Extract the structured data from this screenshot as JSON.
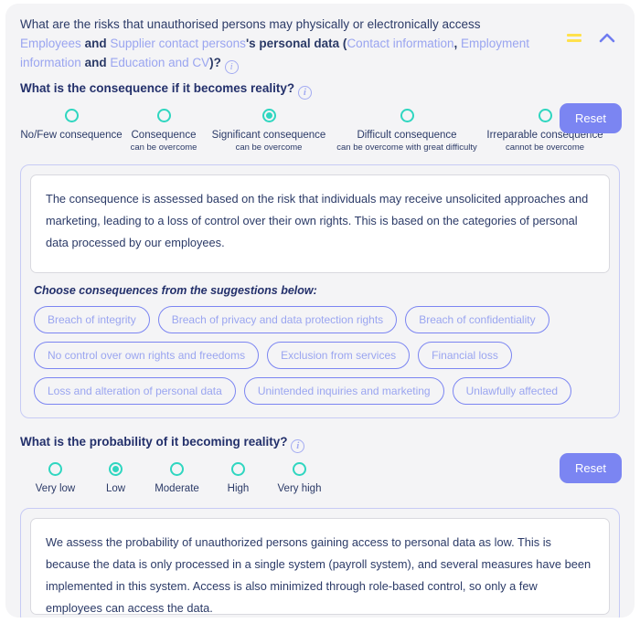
{
  "header": {
    "question_line1": "What are the risks that unauthorised persons may physically or electronically access",
    "link_employees": "Employees",
    "and_1": "and",
    "link_supplier": "Supplier contact persons",
    "mid_text": "'s personal data (",
    "link_contact_info": "Contact information",
    "comma": ", ",
    "link_employment_info": "Employment information",
    "and_2": "and",
    "link_education": "Education and CV",
    "tail_text": ")?",
    "info_icon": "info-icon",
    "bars_icon": "bars-icon",
    "chevron_icon": "chevron-up-icon"
  },
  "consequence": {
    "label": "What is the consequence if it becomes reality?",
    "reset_label": "Reset",
    "selected_index": 2,
    "options": [
      {
        "label": "No/Few consequence",
        "sub": ""
      },
      {
        "label": "Consequence",
        "sub": "can be overcome"
      },
      {
        "label": "Significant consequence",
        "sub": "can be overcome"
      },
      {
        "label": "Difficult consequence",
        "sub": "can be overcome with great difficulty"
      },
      {
        "label": "Irreparable consequence",
        "sub": "cannot be overcome"
      }
    ],
    "answer": "The consequence is assessed based on the risk that individuals may receive unsolicited approaches and marketing, leading to a loss of control over their own rights. This is based on the categories of personal data processed by our employees.",
    "suggestions_title": "Choose consequences from the suggestions below:",
    "suggestions": [
      "Breach of integrity",
      "Breach of privacy and data protection rights",
      "Breach of confidentiality",
      "No control over own rights and freedoms",
      "Exclusion from services",
      "Financial loss",
      "Loss and alteration of personal data",
      "Unintended inquiries and marketing",
      "Unlawfully affected"
    ]
  },
  "probability": {
    "label": "What is the probability of it becoming reality?",
    "reset_label": "Reset",
    "selected_index": 1,
    "options": [
      "Very low",
      "Low",
      "Moderate",
      "High",
      "Very high"
    ],
    "answer": "We assess the probability of unauthorized persons gaining access to personal data as low. This is because the data is only processed in a single system (payroll system), and several measures have been implemented in this system. Access is also minimized through role-based control, so only a few employees can access the data."
  },
  "colors": {
    "accent_teal": "#2fd6c0",
    "accent_indigo": "#7b85f2",
    "link": "#9aa5f0",
    "text": "#2b3a67",
    "yellow": "#ffe14d"
  }
}
